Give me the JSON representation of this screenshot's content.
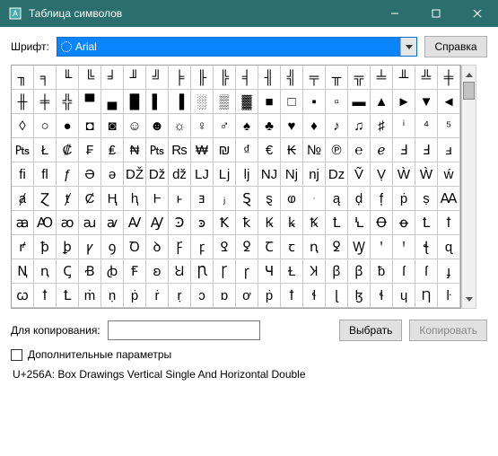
{
  "window": {
    "title": "Таблица символов"
  },
  "font_row": {
    "label": "Шрифт:",
    "selected": "Arial",
    "help_btn": "Справка"
  },
  "grid": {
    "rows": [
      [
        "╖",
        "╕",
        "╙",
        "╚",
        "╛",
        "╜",
        "╝",
        "╞",
        "╟",
        "╠",
        "╡",
        "╢",
        "╣",
        "╤",
        "╥",
        "╦",
        "╧",
        "╨",
        "╩",
        "╪"
      ],
      [
        "╫",
        "╪",
        "╬",
        "▀",
        "▄",
        "█",
        "▌",
        "▐",
        "░",
        "▒",
        "▓",
        "■",
        "□",
        "▪",
        "▫",
        "▬",
        "▲",
        "►",
        "▼",
        "◄"
      ],
      [
        "◊",
        "○",
        "●",
        "◘",
        "◙",
        "☺",
        "☻",
        "☼",
        "♀",
        "♂",
        "♠",
        "♣",
        "♥",
        "♦",
        "♪",
        "♫",
        "♯",
        "ⁱ",
        "⁴",
        "⁵"
      ],
      [
        "₧",
        "Ł",
        "₡",
        "₣",
        "₤",
        "₦",
        "₧",
        "₨",
        "₩",
        "₪",
        "₫",
        "€",
        "₭",
        "№",
        "℗",
        "℮",
        "ℯ",
        "Ⅎ",
        "Ⅎ",
        "ⅎ"
      ],
      [
        "ﬁ",
        "ﬂ",
        "ƒ",
        "Ə",
        "ə",
        "Ǆ",
        "ǅ",
        "ǆ",
        "Ǉ",
        "ǈ",
        "ǉ",
        "Ǌ",
        "ǋ",
        "ǌ",
        "ǲ",
        "Ṽ",
        "Ṿ",
        "Ẁ",
        "Ẁ",
        "ẃ"
      ],
      [
        "ⱥ",
        "Ɀ",
        "ⱦ",
        "Ȼ",
        "Ⱨ",
        "ⱨ",
        "Ⱶ",
        "ⱶ",
        "ⱻ",
        "ⱼ",
        "Ȿ",
        "ȿ",
        "ⱷ",
        "ּ",
        "ą",
        "ḑ",
        "f͎",
        "ṗ",
        "ṣ",
        "Ꜳ"
      ],
      [
        "ꜳ",
        "Ꜵ",
        "ꜵ",
        "ꜷ",
        "ꜹ",
        "Ꜹ",
        "Ꜽ",
        "Ꜿ",
        "ꜿ",
        "Ꝁ",
        "ꝁ",
        "Ꝃ",
        "ꝃ",
        "Ꝅ",
        "Ꝉ",
        "Ꝇ",
        "Ꝋ",
        "ꝋ",
        "Ꝉ",
        "ꝉ"
      ],
      [
        "ꝵ",
        "ꝥ",
        "ꝧ",
        "ꝩ",
        "ꝯ",
        "Ꝺ",
        "ꝺ",
        "Ꝼ",
        "ꝼ",
        "Ꝿ",
        "ꝿ",
        "Ꞇ",
        "ꞇ",
        "ꞑ",
        "ꝿ",
        "Ꝡ",
        "ꞌ",
        "Ꞌ",
        "ꞎ",
        "ɋ"
      ],
      [
        "Ꞑ",
        "ꞑ",
        "Ꞔ",
        "Ꞗ",
        "ꞗ",
        "Ꞙ",
        "ꞝ",
        "Ꞟ",
        "Ꞃ",
        "Ꞅ",
        "ꞅ",
        "Ɥ",
        "Ɫ",
        "Ʞ",
        "ꞵ",
        "ꞵ",
        "ƀ",
        "ſ",
        "ſ",
        "ɟ"
      ],
      [
        "ꞷ",
        "ꝉ",
        "Ꝉ",
        "ṁ",
        "ṇ",
        "ṗ",
        "ṙ",
        "ṛ",
        "ɔ",
        "ɒ",
        "ơ",
        "ṗ",
        "ꝉ",
        "ɬ",
        "ɭ",
        "ɮ",
        "ɬ",
        "ɥ",
        "Ƞ",
        "ŀ"
      ]
    ]
  },
  "copy_row": {
    "label": "Для копирования:",
    "value": "",
    "select_btn": "Выбрать",
    "copy_btn": "Копировать"
  },
  "advanced": {
    "label": "Дополнительные параметры",
    "checked": false
  },
  "status": "U+256A: Box Drawings Vertical Single And Horizontal Double"
}
